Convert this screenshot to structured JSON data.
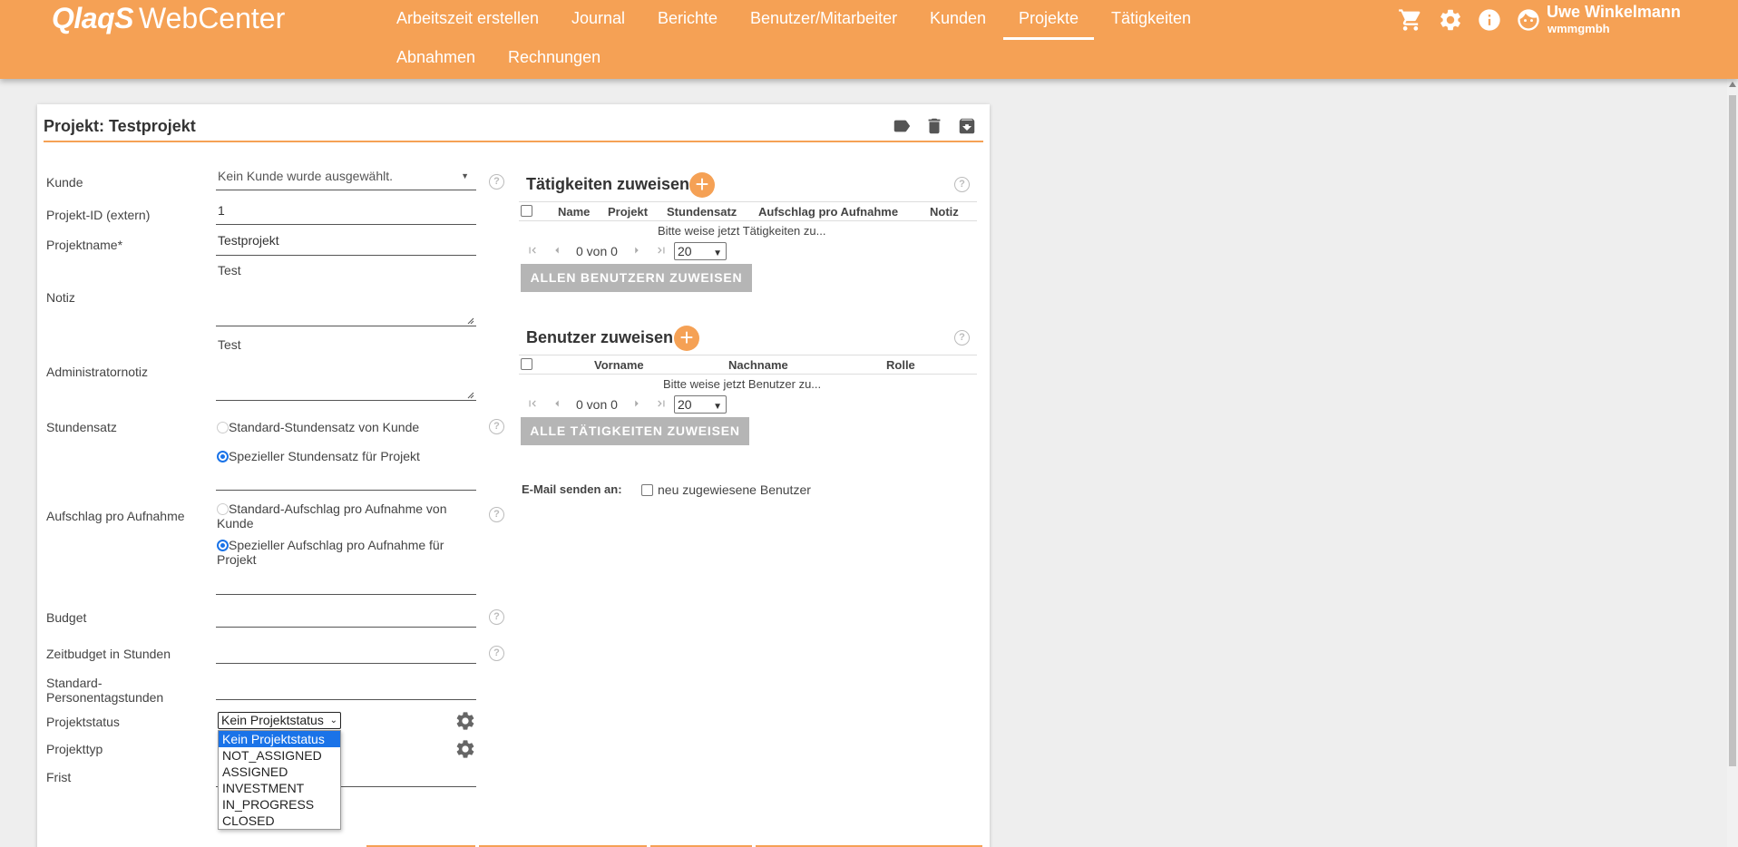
{
  "header": {
    "logo_brand": "QlaqS",
    "logo_rest": "WebCenter",
    "nav": [
      {
        "label": "Arbeitszeit erstellen"
      },
      {
        "label": "Journal"
      },
      {
        "label": "Berichte"
      },
      {
        "label": "Benutzer/Mitarbeiter"
      },
      {
        "label": "Kunden"
      },
      {
        "label": "Projekte",
        "active": true
      },
      {
        "label": "Tätigkeiten"
      },
      {
        "label": "Abnahmen"
      },
      {
        "label": "Rechnungen"
      }
    ],
    "icons": [
      "cart-icon",
      "gear-icon",
      "info-icon",
      "user-avatar-icon"
    ],
    "user_name": "Uwe Winkelmann",
    "user_company": "wmmgmbh",
    "accent_color": "#f5a155"
  },
  "card": {
    "title": "Projekt: Testprojekt",
    "actions": [
      "label-icon",
      "delete-icon",
      "archive-icon"
    ]
  },
  "form": {
    "kunde_label": "Kunde",
    "kunde_value": "Kein Kunde wurde ausgewählt.",
    "projekt_id_label": "Projekt-ID (extern)",
    "projekt_id_value": "1",
    "projektname_label": "Projektname*",
    "projektname_value": "Testprojekt",
    "notiz_label": "Notiz",
    "notiz_value": "Test",
    "adminnotiz_label": "Administratornotiz",
    "adminnotiz_value": "Test",
    "stundensatz_label": "Stundensatz",
    "stundensatz_opt1": "Standard-Stundensatz von Kunde",
    "stundensatz_opt2": "Spezieller Stundensatz für Projekt",
    "aufschlag_label": "Aufschlag pro Aufnahme",
    "aufschlag_opt1": "Standard-Aufschlag pro Aufnahme von Kunde",
    "aufschlag_opt2": "Spezieller Aufschlag pro Aufnahme für Projekt",
    "budget_label": "Budget",
    "zeitbudget_label": "Zeitbudget in Stunden",
    "personentag_label": "Standard-Personentagstunden",
    "projektstatus_label": "Projektstatus",
    "projektstatus_value": "Kein Projektstatus",
    "projektstatus_options": [
      "Kein Projektstatus",
      "NOT_ASSIGNED",
      "ASSIGNED",
      "INVESTMENT",
      "IN_PROGRESS",
      "CLOSED"
    ],
    "projekttyp_label": "Projekttyp",
    "frist_label": "Frist",
    "help_glyph": "?"
  },
  "taetigkeiten": {
    "title": "Tätigkeiten zuweisen",
    "columns": [
      "Name",
      "Projekt",
      "Stundensatz",
      "Aufschlag pro Aufnahme",
      "Notiz"
    ],
    "empty": "Bitte weise jetzt Tätigkeiten zu...",
    "pager_text": "0 von 0",
    "page_size": "20",
    "button": "ALLEN BENUTZERN ZUWEISEN"
  },
  "benutzer": {
    "title": "Benutzer zuweisen",
    "columns": [
      "Vorname",
      "Nachname",
      "Rolle"
    ],
    "empty": "Bitte weise jetzt Benutzer zu...",
    "pager_text": "0 von 0",
    "page_size": "20",
    "button": "ALLE TÄTIGKEITEN ZUWEISEN"
  },
  "email": {
    "label": "E-Mail senden an:",
    "option": "neu zugewiesene Benutzer"
  }
}
